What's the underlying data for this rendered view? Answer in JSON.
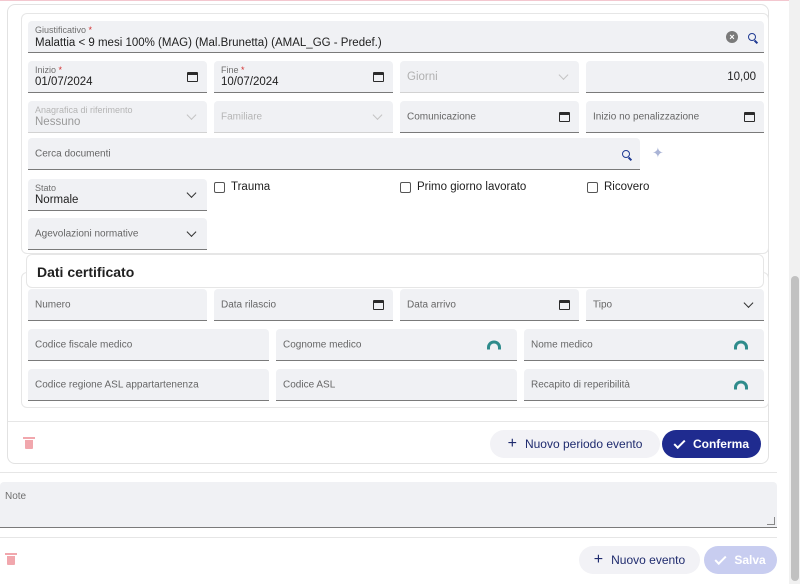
{
  "evento": {
    "giustificativo": {
      "label": "Giustificativo",
      "value": "Malattia < 9 mesi 100% (MAG) (Mal.Brunetta) (AMAL_GG - Predef.)"
    },
    "inizio": {
      "label": "Inizio",
      "value": "01/07/2024"
    },
    "fine": {
      "label": "Fine",
      "value": "10/07/2024"
    },
    "giorni": {
      "placeholder": "Giorni"
    },
    "quantita": {
      "value": "10,00"
    },
    "anagrafica": {
      "label": "Anagrafica di riferimento",
      "value": "Nessuno"
    },
    "familiare": {
      "label": "Familiare"
    },
    "comunicazione": {
      "label": "Comunicazione"
    },
    "inizio_no_penalizzazione": {
      "label": "Inizio no penalizzazione"
    },
    "cerca_documenti": {
      "label": "Cerca documenti"
    },
    "stato": {
      "label": "Stato",
      "value": "Normale"
    },
    "checkboxes": {
      "trauma": "Trauma",
      "primo_giorno": "Primo giorno lavorato",
      "ricovero": "Ricovero"
    },
    "agevolazioni": {
      "label": "Agevolazioni normative"
    }
  },
  "certificato": {
    "title": "Dati certificato",
    "numero": "Numero",
    "data_rilascio": "Data rilascio",
    "data_arrivo": "Data arrivo",
    "tipo": "Tipo",
    "codice_fiscale_medico": "Codice fiscale medico",
    "cognome_medico": "Cognome medico",
    "nome_medico": "Nome medico",
    "codice_regione_asl": "Codice regione ASL appartartenenza",
    "codice_asl": "Codice ASL",
    "recapito_reperibilita": "Recapito di reperibilità"
  },
  "periodo_actions": {
    "nuovo_periodo": "Nuovo periodo evento",
    "conferma": "Conferma"
  },
  "note": {
    "label": "Note"
  },
  "footer_actions": {
    "nuovo_evento": "Nuovo evento",
    "salva": "Salva"
  },
  "colors": {
    "primary": "#1f2b8f",
    "field_bg": "#f0f1f4",
    "required": "#d32f2f",
    "delete": "#f1a7ad",
    "medico_icon": "#2e8b8b"
  }
}
